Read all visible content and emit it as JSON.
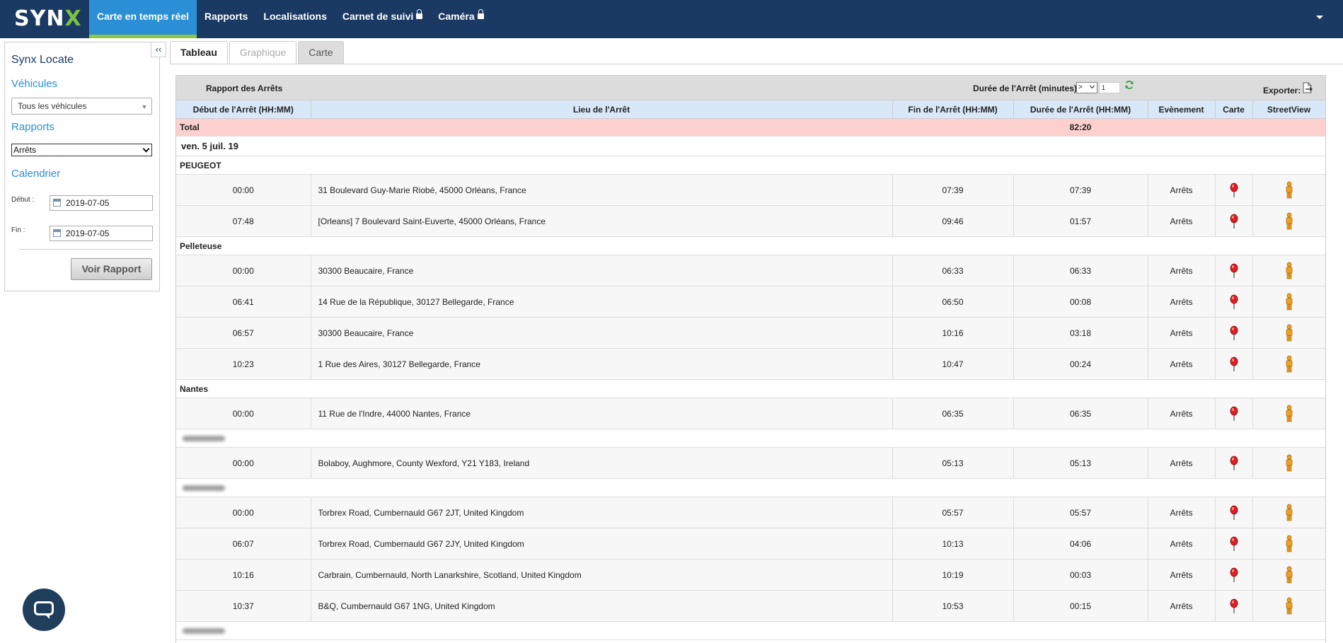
{
  "app": {
    "logo_main": "SYN",
    "logo_x": "X",
    "colors": {
      "nav_bg": "#1b3a63",
      "nav_active": "#2b8fd6",
      "nav_active_underline": "#8dc63f",
      "total_row": "#fdd0d0",
      "header_row": "#d8e8f8"
    }
  },
  "nav": {
    "items": [
      {
        "label": "Carte en temps réel",
        "active": true,
        "locked": false
      },
      {
        "label": "Rapports",
        "active": false,
        "locked": false
      },
      {
        "label": "Localisations",
        "active": false,
        "locked": false
      },
      {
        "label": "Carnet de suivi",
        "active": false,
        "locked": true
      },
      {
        "label": "Caméra",
        "active": false,
        "locked": true
      }
    ]
  },
  "sidebar": {
    "collapse_label": "‹‹",
    "title": "Synx Locate",
    "vehicles_heading": "Véhicules",
    "vehicles_select": "Tous les véhicules",
    "reports_heading": "Rapports",
    "reports_select": "Arrêts",
    "calendar_heading": "Calendrier",
    "start_label": "Début :",
    "start_value": "2019-07-05",
    "end_label": "Fin :",
    "end_value": "2019-07-05",
    "submit_label": "Voir Rapport"
  },
  "tabs": [
    {
      "label": "Tableau",
      "state": "active"
    },
    {
      "label": "Graphique",
      "state": "disabled"
    },
    {
      "label": "Carte",
      "state": "normal"
    }
  ],
  "report": {
    "title": "Rapport des Arrêts",
    "duration_label": "Durée de l'Arrêt (minutes)",
    "duration_operator": ">",
    "duration_value": "1",
    "export_label": "Exporter:",
    "columns": [
      "Début de l'Arrêt (HH:MM)",
      "Lieu de l'Arrêt",
      "Fin de l'Arrêt (HH:MM)",
      "Durée de l'Arrêt (HH:MM)",
      "Evènement",
      "Carte",
      "StreetView"
    ],
    "total_label": "Total",
    "total_duration": "82:20",
    "date_label": "ven. 5 juil. 19",
    "groups": [
      {
        "name": "PEUGEOT",
        "blurred": false,
        "rows": [
          {
            "start": "00:00",
            "location": "31 Boulevard Guy-Marie Riobé, 45000 Orléans, France",
            "end": "07:39",
            "duration": "07:39",
            "event": "Arrêts"
          },
          {
            "start": "07:48",
            "location": "[Orleans] 7 Boulevard Saint-Euverte, 45000 Orléans, France",
            "end": "09:46",
            "duration": "01:57",
            "event": "Arrêts"
          }
        ]
      },
      {
        "name": "Pelleteuse",
        "blurred": false,
        "rows": [
          {
            "start": "00:00",
            "location": "30300 Beaucaire, France",
            "end": "06:33",
            "duration": "06:33",
            "event": "Arrêts"
          },
          {
            "start": "06:41",
            "location": "14 Rue de la République, 30127 Bellegarde, France",
            "end": "06:50",
            "duration": "00:08",
            "event": "Arrêts"
          },
          {
            "start": "06:57",
            "location": "30300 Beaucaire, France",
            "end": "10:16",
            "duration": "03:18",
            "event": "Arrêts"
          },
          {
            "start": "10:23",
            "location": "1 Rue des Aires, 30127 Bellegarde, France",
            "end": "10:47",
            "duration": "00:24",
            "event": "Arrêts"
          }
        ]
      },
      {
        "name": "Nantes",
        "blurred": false,
        "rows": [
          {
            "start": "00:00",
            "location": "11 Rue de l'Indre, 44000 Nantes, France",
            "end": "06:35",
            "duration": "06:35",
            "event": "Arrêts"
          }
        ]
      },
      {
        "name": "",
        "blurred": true,
        "rows": [
          {
            "start": "00:00",
            "location": "Bolaboy, Aughmore, County Wexford, Y21 Y183, Ireland",
            "end": "05:13",
            "duration": "05:13",
            "event": "Arrêts"
          }
        ]
      },
      {
        "name": "",
        "blurred": true,
        "rows": [
          {
            "start": "00:00",
            "location": "Torbrex Road, Cumbernauld G67 2JT, United Kingdom",
            "end": "05:57",
            "duration": "05:57",
            "event": "Arrêts"
          },
          {
            "start": "06:07",
            "location": "Torbrex Road, Cumbernauld G67 2JY, United Kingdom",
            "end": "10:13",
            "duration": "04:06",
            "event": "Arrêts"
          },
          {
            "start": "10:16",
            "location": "Carbrain, Cumbernauld, North Lanarkshire, Scotland, United Kingdom",
            "end": "10:19",
            "duration": "00:03",
            "event": "Arrêts"
          },
          {
            "start": "10:37",
            "location": "B&Q, Cumbernauld G67 1NG, United Kingdom",
            "end": "10:53",
            "duration": "00:15",
            "event": "Arrêts"
          }
        ]
      },
      {
        "name": "",
        "blurred": true,
        "rows": []
      }
    ]
  }
}
